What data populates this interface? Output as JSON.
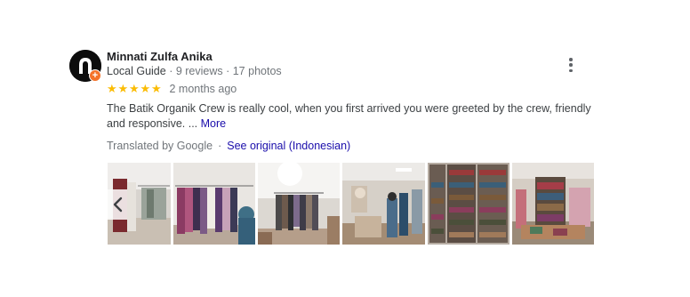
{
  "reviewer": {
    "name": "Minnati Zulfa Anika",
    "role": "Local Guide",
    "reviews": "9 reviews",
    "photos": "17 photos",
    "meta_separator": " · "
  },
  "rating": {
    "stars": 5,
    "max": 5,
    "time_ago": "2 months ago"
  },
  "review": {
    "text": "The Batik Organik Crew is really cool, when you first arrived you were greeted by the crew, friendly and responsive. ... ",
    "more_label": "More"
  },
  "translation": {
    "label": "Translated by Google",
    "separator": "·",
    "see_original_label": "See original (Indonesian)"
  },
  "photos": [
    {
      "name": "store-photo-1"
    },
    {
      "name": "store-photo-2"
    },
    {
      "name": "store-photo-3"
    },
    {
      "name": "store-photo-4"
    },
    {
      "name": "store-photo-5"
    },
    {
      "name": "store-photo-6"
    }
  ],
  "icons": {
    "menu": "more-vert-icon",
    "prev": "chevron-left-icon",
    "badge": "local-guide-badge-icon",
    "star": "star-icon"
  },
  "colors": {
    "star": "#fbbc04",
    "link": "#1a0dab",
    "badge": "#f4732a",
    "muted": "#70757a",
    "text": "#3c4043"
  }
}
